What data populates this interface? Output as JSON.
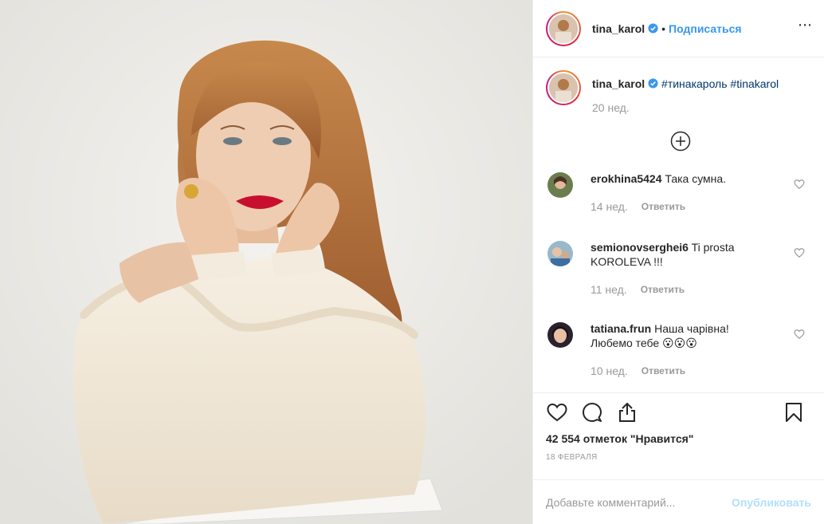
{
  "photo": {
    "alt_icon": "portrait-photo"
  },
  "header": {
    "username": "tina_karol",
    "dot": "•",
    "follow_label": "Подписаться",
    "more_icon": "more-icon"
  },
  "caption": {
    "username": "tina_karol",
    "tags": [
      "#тинакароль",
      "#tinakarol"
    ],
    "time": "20 нед."
  },
  "load_more_icon": "plus-circle-icon",
  "comments": [
    {
      "username": "erokhina5424",
      "text": "Така сумна.",
      "time": "14 нед.",
      "reply": "Ответить"
    },
    {
      "username": "semionovserghei6",
      "text": "Ti prosta KOROLEVA !!!",
      "time": "11 нед.",
      "reply": "Ответить"
    },
    {
      "username": "tatiana.frun",
      "text": "Наша чарівна! Любемо тебе 😮😮😮",
      "time": "10 нед.",
      "reply": "Ответить"
    }
  ],
  "likes": "42 554 отметок \"Нравится\"",
  "date": "18 ФЕВРАЛЯ",
  "add_comment": {
    "placeholder": "Добавьте комментарий...",
    "publish_label": "Опубликовать"
  },
  "colors": {
    "accent": "#3897f0",
    "muted": "#999999",
    "publish_disabled": "#b2dffc",
    "tag": "#003569"
  }
}
